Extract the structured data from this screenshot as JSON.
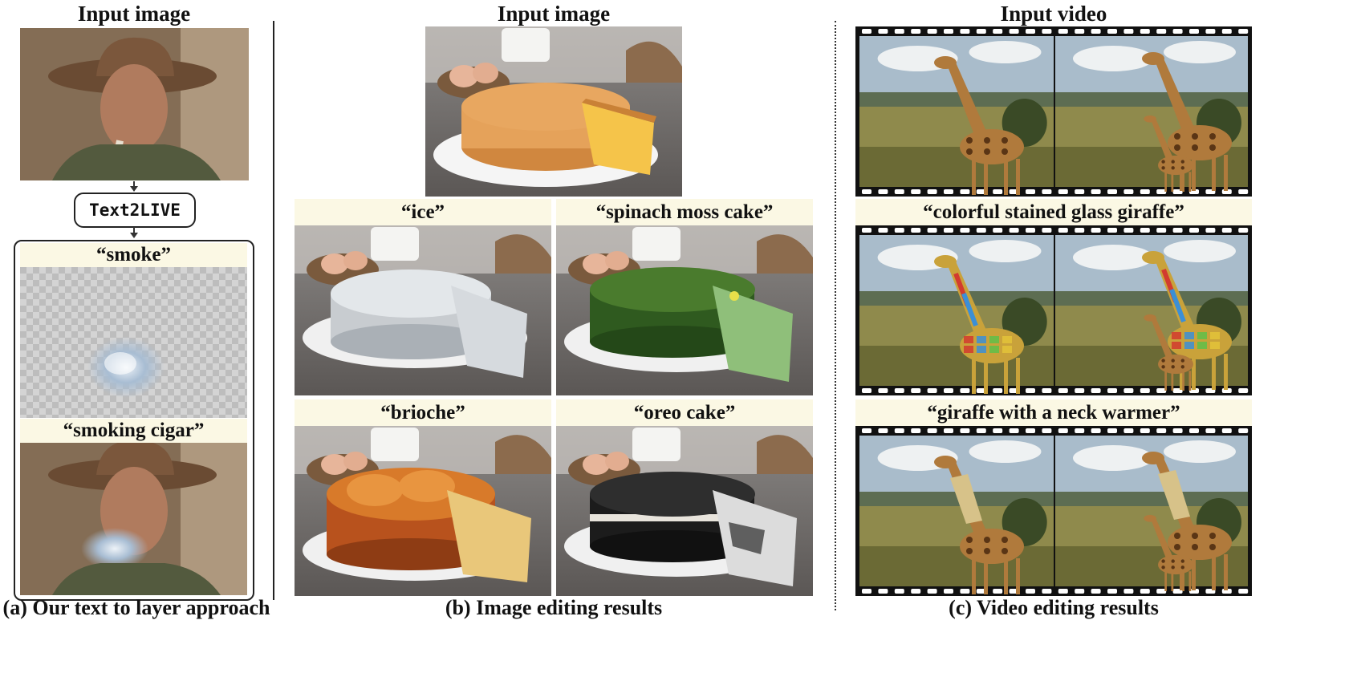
{
  "panel_a": {
    "heading": "Input image",
    "method_label": "Text2LIVE",
    "prompt_1": "“smoke”",
    "prompt_2": "“smoking cigar”",
    "caption": "(a) Our text to layer approach"
  },
  "panel_b": {
    "heading": "Input image",
    "prompts": [
      "“ice”",
      "“spinach moss cake”",
      "“brioche”",
      "“oreo cake”"
    ],
    "caption": "(b) Image editing results"
  },
  "panel_c": {
    "heading": "Input video",
    "prompt_1": "“colorful stained glass giraffe”",
    "prompt_2": "“giraffe with a neck warmer”",
    "caption": "(c) Video editing results"
  }
}
